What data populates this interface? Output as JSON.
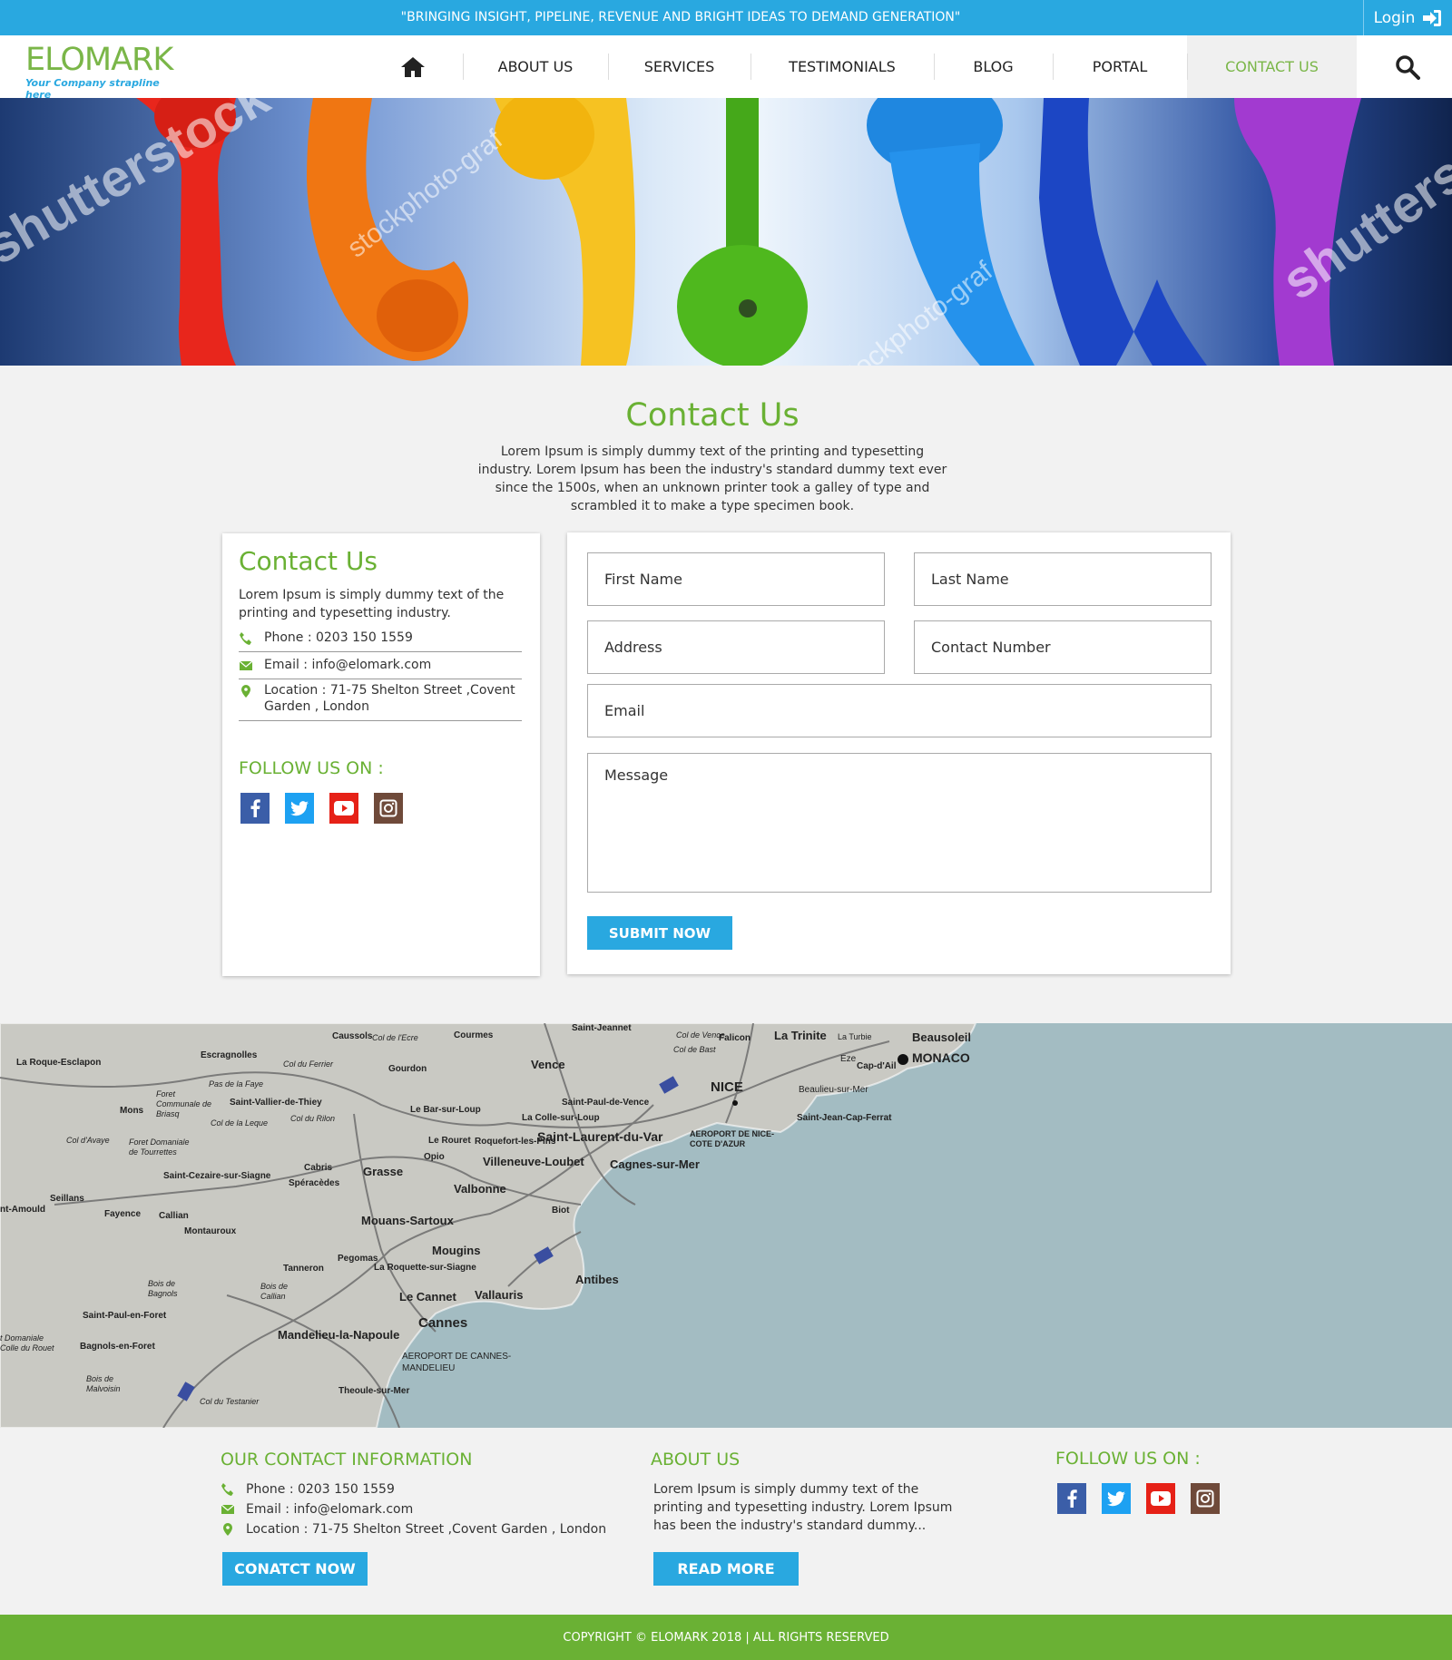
{
  "topbar": {
    "tagline": "\"BRINGING INSIGHT, PIPELINE, REVENUE AND BRIGHT IDEAS TO DEMAND GENERATION\"",
    "login_label": "Login",
    "login_icon": "sign-in-icon"
  },
  "header": {
    "logo_text": "ELOMARK",
    "logo_strapline": "Your Company strapline here",
    "nav": [
      {
        "label": "",
        "icon": "home-icon"
      },
      {
        "label": "ABOUT US"
      },
      {
        "label": "SERVICES"
      },
      {
        "label": "TESTIMONIALS"
      },
      {
        "label": "BLOG"
      },
      {
        "label": "PORTAL"
      },
      {
        "label": "CONTACT US",
        "active": true
      }
    ],
    "search_icon": "search-icon"
  },
  "hero": {
    "watermarks": [
      "shutterstock",
      "stockphoto-graf",
      "stockphoto-graf",
      "shutterst"
    ]
  },
  "intro": {
    "title": "Contact Us",
    "text": "Lorem Ipsum is simply dummy text of the printing and typesetting industry. Lorem Ipsum has been the industry's standard dummy text ever since the 1500s, when an unknown printer took a galley of type and scrambled it to make a type specimen book."
  },
  "info_card": {
    "title": "Contact Us",
    "description": "Lorem Ipsum is simply dummy text of the printing and typesetting industry.",
    "phone": "Phone : 0203 150 1559",
    "email": "Email : info@elomark.com",
    "location": "Location : 71-75 Shelton Street ,Covent Garden , London",
    "follow_heading": "FOLLOW US ON :"
  },
  "form": {
    "first_name_placeholder": "First Name",
    "last_name_placeholder": "Last Name",
    "address_placeholder": "Address",
    "contact_number_placeholder": "Contact Number",
    "email_placeholder": "Email",
    "message_placeholder": "Message",
    "submit_label": "SUBMIT NOW"
  },
  "map": {
    "places": [
      "Beausoleil",
      "MONACO",
      "La Trinite",
      "La Turbie",
      "Falicon",
      "Eze",
      "Cap-d'Ail",
      "Beaulieu-sur-Mer",
      "Saint-Jean-Cap-Ferrat",
      "NICE",
      "Saint-Jeannet",
      "Vence",
      "Courmes",
      "Caussols",
      "Col de l'Ecre",
      "Gourdon",
      "Escragnolles",
      "La Roque-Esclapon",
      "Col du Ferrier",
      "Pas de la Faye",
      "Foret Communale de Briasq",
      "Mons",
      "Saint-Vallier-de-Thiey",
      "Col du Rilon",
      "Le Bar-sur-Loup",
      "La Colle-sur-Loup",
      "Saint-Paul-de-Vence",
      "Saint-Laurent-du-Var",
      "AEROPORT DE NICE-COTE D'AZUR",
      "Cagnes-sur-Mer",
      "Villeneuve-Loubet",
      "Roquefort-les-Pins",
      "Le Rouret",
      "Opio",
      "Col de la Leque",
      "Col d'Avaye",
      "Foret Domaniale de Tourrettes",
      "Saint-Cezaire-sur-Siagne",
      "Cabris",
      "Grasse",
      "Spéracèdes",
      "Valbonne",
      "Biot",
      "Seillans",
      "Fayence",
      "Callian",
      "Montauroux",
      "Mouans-Sartoux",
      "Mougins",
      "Antibes",
      "Pegomas",
      "La Roquette-sur-Siagne",
      "Tanneron",
      "Bois de Bagnols",
      "Bois de Callian",
      "Le Cannet",
      "Vallauris",
      "Cannes",
      "Saint-Paul-en-Foret",
      "Mandelieu-la-Napoule",
      "AEROPORT DE CANNES-MANDELIEU",
      "Bagnols-en-Foret",
      "Bois de Malvoisin",
      "Col du Testanier",
      "Theoule-sur-Mer",
      "Col de Bast",
      "Col de Vence",
      "nt-Amould",
      "t Domaniale Colle du Rouet"
    ]
  },
  "footer": {
    "contact_heading": "OUR CONTACT INFORMATION",
    "phone": "Phone : 0203 150 1559",
    "email": "Email : info@elomark.com",
    "location": "Location : 71-75 Shelton Street ,Covent Garden , London",
    "contact_button": "CONATCT NOW",
    "about_heading": "ABOUT US",
    "about_text": "Lorem Ipsum is simply dummy text of the printing and typesetting industry. Lorem Ipsum has been the industry's standard dummy...",
    "read_more": "READ MORE",
    "follow_heading": "FOLLOW US ON :"
  },
  "copyright": "COPYRIGHT © ELOMARK 2018 | ALL RIGHTS RESERVED",
  "colors": {
    "brand_blue": "#29a8e0",
    "brand_green": "#6ab134",
    "facebook": "#3b5ea8",
    "twitter": "#1da1f2",
    "youtube": "#e62117",
    "instagram": "#6f4a3a"
  }
}
